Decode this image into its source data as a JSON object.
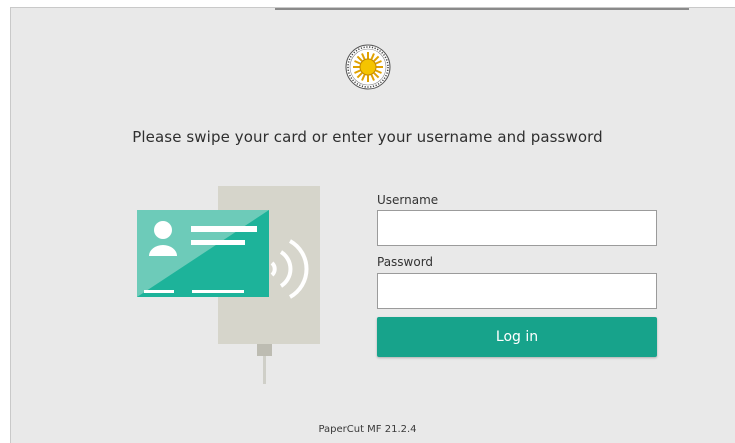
{
  "instructions": "Please swipe your card or enter your username and password",
  "login_form": {
    "username_label": "Username",
    "username_value": "",
    "password_label": "Password",
    "password_value": "",
    "login_button_label": "Log in"
  },
  "footer": {
    "version": "PaperCut MF 21.2.4"
  },
  "icons": {
    "logo": "university-seal-icon",
    "illustration": "card-reader-swipe-icon"
  },
  "colors": {
    "accent": "#17a38b",
    "card": "#1db39a",
    "reader": "#d6d5cb",
    "background": "#e9e9e9"
  }
}
